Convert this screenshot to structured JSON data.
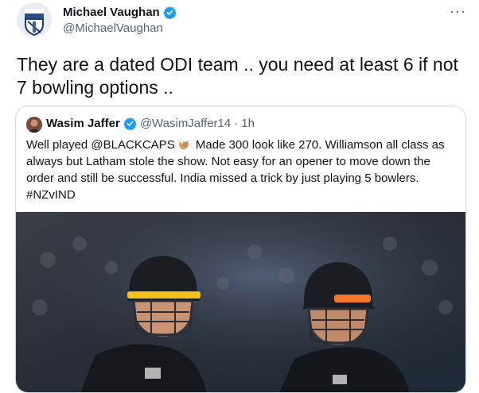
{
  "tweet": {
    "author_name": "Michael Vaughan",
    "author_handle": "@MichaelVaughan",
    "avatar_label": "The Telegraph VSTCC",
    "more_label": "···",
    "text": "They are a dated ODI team .. you need at least 6 if not 7 bowling options .."
  },
  "quote": {
    "author_name": "Wasim Jaffer",
    "author_handle": "@WasimJaffer14",
    "separator": "·",
    "time": "1h",
    "text_before_emoji": "Well played @BLACKCAPS",
    "emoji": "clapping-hands-emoji",
    "text_after_emoji": " Made 300 look like 270. Williamson all class as always but Latham stole the show. Not easy for an opener to move down the order and still be successful. India missed a trick by just playing 5 bowlers. #NZvIND",
    "image_description_icon": "cricket-players-photo"
  },
  "colors": {
    "verified_blue": "#1d9bf0",
    "text_primary": "#0f1419",
    "text_secondary": "#536471",
    "border": "#cfd9de",
    "helmet_dark": "#1a1d22",
    "helmet_orange": "#f07a2a"
  }
}
